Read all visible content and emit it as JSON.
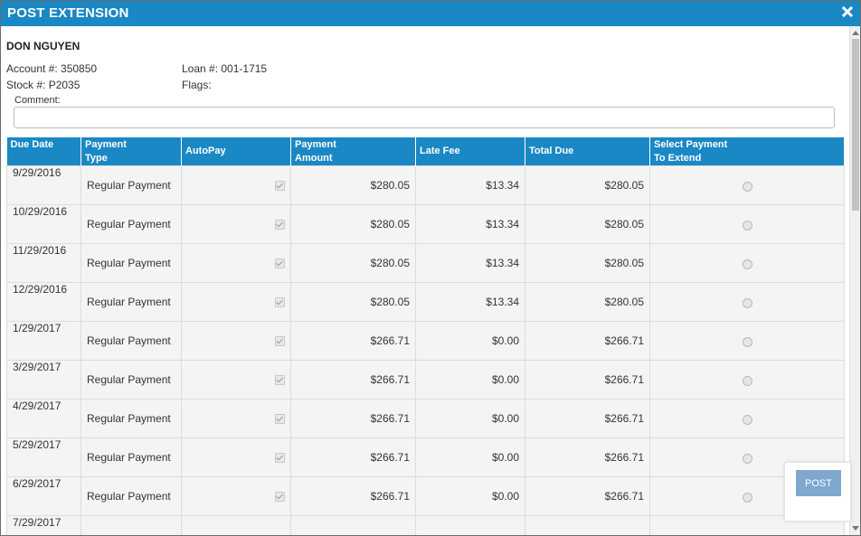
{
  "window": {
    "title": "POST EXTENSION",
    "close_icon": "close-icon"
  },
  "customer": {
    "name": "DON NGUYEN",
    "account": "Account #: 350850",
    "stock": "Stock #: P2035",
    "loan": "Loan #: 001-1715",
    "flags": "Flags:"
  },
  "comment": {
    "label": "Comment:",
    "value": "",
    "placeholder": ""
  },
  "table": {
    "headers": {
      "due_date": "Due Date",
      "payment_type": "Payment\nType",
      "autopay": "AutoPay",
      "payment_amount": "Payment\nAmount",
      "late_fee": "Late Fee",
      "total_due": "Total Due",
      "select": "Select Payment\nTo Extend"
    },
    "rows": [
      {
        "due_date": "9/29/2016",
        "type": "Regular Payment",
        "autopay": true,
        "amount": "$280.05",
        "late_fee": "$13.34",
        "total_due": "$280.05",
        "selected": false
      },
      {
        "due_date": "10/29/2016",
        "type": "Regular Payment",
        "autopay": true,
        "amount": "$280.05",
        "late_fee": "$13.34",
        "total_due": "$280.05",
        "selected": false
      },
      {
        "due_date": "11/29/2016",
        "type": "Regular Payment",
        "autopay": true,
        "amount": "$280.05",
        "late_fee": "$13.34",
        "total_due": "$280.05",
        "selected": false
      },
      {
        "due_date": "12/29/2016",
        "type": "Regular Payment",
        "autopay": true,
        "amount": "$280.05",
        "late_fee": "$13.34",
        "total_due": "$280.05",
        "selected": false
      },
      {
        "due_date": "1/29/2017",
        "type": "Regular Payment",
        "autopay": true,
        "amount": "$266.71",
        "late_fee": "$0.00",
        "total_due": "$266.71",
        "selected": false
      },
      {
        "due_date": "3/29/2017",
        "type": "Regular Payment",
        "autopay": true,
        "amount": "$266.71",
        "late_fee": "$0.00",
        "total_due": "$266.71",
        "selected": false
      },
      {
        "due_date": "4/29/2017",
        "type": "Regular Payment",
        "autopay": true,
        "amount": "$266.71",
        "late_fee": "$0.00",
        "total_due": "$266.71",
        "selected": false
      },
      {
        "due_date": "5/29/2017",
        "type": "Regular Payment",
        "autopay": true,
        "amount": "$266.71",
        "late_fee": "$0.00",
        "total_due": "$266.71",
        "selected": false
      },
      {
        "due_date": "6/29/2017",
        "type": "Regular Payment",
        "autopay": true,
        "amount": "$266.71",
        "late_fee": "$0.00",
        "total_due": "$266.71",
        "selected": false
      },
      {
        "due_date": "7/29/2017",
        "type": "",
        "autopay": false,
        "amount": "",
        "late_fee": "",
        "total_due": "",
        "selected": false
      }
    ]
  },
  "actions": {
    "post_label": "POST"
  },
  "colors": {
    "header_blue": "#1a88c4",
    "post_button": "#7fa8cf"
  }
}
